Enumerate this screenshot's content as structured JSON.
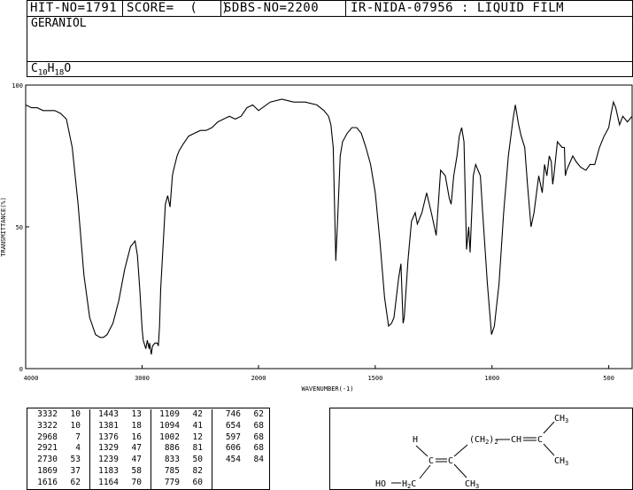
{
  "header": {
    "hit_no": "HIT-NO=1791",
    "score": "SCORE=  (   )",
    "sdbs_no": "SDBS-NO=2200",
    "ir_id": "IR-NIDA-07956 : LIQUID FILM"
  },
  "compound": {
    "name": "GERANIOL",
    "formula_c": "C",
    "formula_c_sub": "10",
    "formula_h": "H",
    "formula_h_sub": "18",
    "formula_o": "O"
  },
  "chart_data": {
    "type": "line",
    "xlabel": "WAVENUMBER(-1)",
    "ylabel": "TRANSMITTANCE(%)",
    "xlim": [
      4000,
      400
    ],
    "ylim": [
      0,
      100
    ],
    "x_ticks": [
      4000,
      3000,
      2000,
      1500,
      1000,
      500
    ],
    "y_ticks": [
      0,
      50,
      100
    ],
    "grid": false,
    "series": [
      {
        "x": [
          4000,
          3950,
          3900,
          3850,
          3800,
          3750,
          3700,
          3650,
          3600,
          3550,
          3500,
          3450,
          3400,
          3360,
          3332,
          3300,
          3250,
          3200,
          3150,
          3100,
          3060,
          3040,
          3020,
          3000,
          2990,
          2968,
          2955,
          2940,
          2935,
          2921,
          2910,
          2890,
          2870,
          2860,
          2850,
          2840,
          2800,
          2780,
          2760,
          2740,
          2730,
          2700,
          2680,
          2650,
          2600,
          2550,
          2500,
          2450,
          2400,
          2350,
          2300,
          2250,
          2200,
          2150,
          2100,
          2050,
          2000,
          1950,
          1900,
          1850,
          1800,
          1750,
          1720,
          1700,
          1690,
          1680,
          1675,
          1669,
          1660,
          1650,
          1640,
          1620,
          1600,
          1580,
          1560,
          1540,
          1520,
          1500,
          1480,
          1460,
          1443,
          1430,
          1420,
          1400,
          1390,
          1381,
          1376,
          1360,
          1345,
          1329,
          1320,
          1300,
          1280,
          1260,
          1239,
          1220,
          1200,
          1183,
          1175,
          1164,
          1150,
          1140,
          1130,
          1120,
          1109,
          1100,
          1094,
          1080,
          1070,
          1060,
          1050,
          1040,
          1020,
          1002,
          990,
          970,
          950,
          930,
          910,
          900,
          886,
          875,
          860,
          848,
          833,
          820,
          800,
          785,
          775,
          765,
          755,
          746,
          740,
          735,
          720,
          700,
          690,
          686,
          680,
          670,
          654,
          640,
          620,
          600,
          597,
          580,
          560,
          540,
          520,
          500,
          490,
          480,
          470,
          454,
          440,
          420,
          400
        ],
        "y": [
          93,
          92,
          92,
          91,
          91,
          91,
          90,
          88,
          78,
          58,
          33,
          18,
          12,
          11,
          11,
          12,
          16,
          24,
          35,
          43,
          45,
          40,
          28,
          14,
          10,
          7,
          10,
          7,
          9,
          5,
          8,
          9,
          9,
          8,
          15,
          28,
          58,
          61,
          57,
          68,
          70,
          75,
          77,
          79,
          82,
          83,
          84,
          84,
          85,
          87,
          88,
          89,
          88,
          89,
          92,
          93,
          91,
          94,
          95,
          94,
          94,
          93,
          91,
          89,
          86,
          78,
          60,
          38,
          55,
          75,
          80,
          83,
          85,
          85,
          83,
          78,
          72,
          62,
          45,
          25,
          15,
          16,
          18,
          32,
          37,
          16,
          18,
          38,
          52,
          55,
          51,
          55,
          62,
          55,
          47,
          70,
          68,
          60,
          58,
          68,
          75,
          82,
          85,
          80,
          42,
          50,
          41,
          68,
          72,
          70,
          68,
          55,
          30,
          12,
          15,
          30,
          55,
          75,
          88,
          93,
          86,
          82,
          78,
          65,
          50,
          55,
          68,
          62,
          72,
          68,
          75,
          73,
          65,
          68,
          80,
          78,
          78,
          68,
          70,
          72,
          75,
          73,
          71,
          70,
          70,
          72,
          72,
          78,
          82,
          85,
          90,
          94,
          92,
          86,
          89,
          87,
          89
        ]
      }
    ]
  },
  "peak_table": [
    [
      "3332",
      "10",
      "1443",
      "13",
      "1109",
      "42",
      "746",
      "62"
    ],
    [
      "3322",
      "10",
      "1381",
      "18",
      "1094",
      "41",
      "654",
      "68"
    ],
    [
      "2968",
      "7",
      "1376",
      "16",
      "1002",
      "12",
      "597",
      "68"
    ],
    [
      "2921",
      "4",
      "1329",
      "47",
      "886",
      "81",
      "606",
      "68"
    ],
    [
      "2730",
      "53",
      "1239",
      "47",
      "833",
      "50",
      "454",
      "84"
    ],
    [
      "1869",
      "37",
      "1183",
      "58",
      "785",
      "82",
      "",
      ""
    ],
    [
      "1616",
      "62",
      "1164",
      "70",
      "779",
      "60",
      "",
      ""
    ]
  ],
  "structure": {
    "h": "H",
    "ho": "HO",
    "h2c": "H",
    "h2c_sub": "2",
    "h2c_c": "C",
    "c1": "C",
    "c2": "C",
    "ch3_low": "CH",
    "ch3_low_sub": "3",
    "chain": "(CH",
    "chain_sub1": "2",
    "chain_close": ")",
    "chain_sub2": "2",
    "ch_mid": "CH",
    "c_end": "C",
    "ch3_top": "CH",
    "ch3_top_sub": "3",
    "ch3_bot": "CH",
    "ch3_bot_sub": "3"
  }
}
